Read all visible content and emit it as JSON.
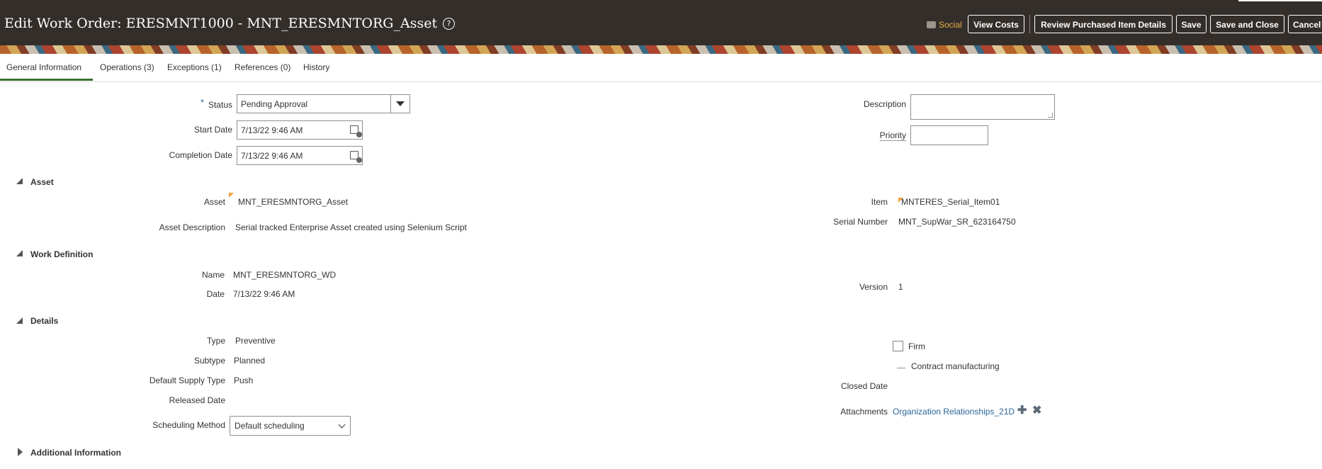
{
  "header": {
    "title": "Edit Work Order: ERESMNT1000 - MNT_ERESMNTORG_Asset",
    "help_glyph": "?",
    "social_label": "Social",
    "buttons": {
      "view_costs": "View Costs",
      "review_purchased": "Review Purchased Item Details",
      "save": "Save",
      "save_and_close": "Save and Close",
      "cancel": "Cancel"
    }
  },
  "tabs": [
    "General Information",
    "Operations (3)",
    "Exceptions (1)",
    "References (0)",
    "History"
  ],
  "general": {
    "status_required": "*",
    "status_label": "Status",
    "status_value": "Pending Approval",
    "start_date_label": "Start Date",
    "start_date_value": "7/13/22 9:46 AM",
    "completion_date_label": "Completion Date",
    "completion_date_value": "7/13/22 9:46 AM",
    "description_label": "Description",
    "description_value": "",
    "priority_label": "Priority",
    "priority_value": ""
  },
  "asset": {
    "section": "Asset",
    "asset_label": "Asset",
    "asset_value": "MNT_ERESMNTORG_Asset",
    "asset_desc_label": "Asset Description",
    "asset_desc_value": "Serial tracked Enterprise Asset created using Selenium Script",
    "item_label": "Item",
    "item_value": "MNTERES_Serial_Item01",
    "serial_label": "Serial Number",
    "serial_value": "MNT_SupWar_SR_623164750"
  },
  "work_definition": {
    "section": "Work Definition",
    "name_label": "Name",
    "name_value": "MNT_ERESMNTORG_WD",
    "date_label": "Date",
    "date_value": "7/13/22 9:46 AM",
    "version_label": "Version",
    "version_value": "1"
  },
  "details": {
    "section": "Details",
    "type_label": "Type",
    "type_value": "Preventive",
    "subtype_label": "Subtype",
    "subtype_value": "Planned",
    "supply_label": "Default Supply Type",
    "supply_value": "Push",
    "released_label": "Released Date",
    "released_value": "",
    "scheduling_label": "Scheduling Method",
    "scheduling_value": "Default scheduling",
    "firm_label": "Firm",
    "firm_checked": false,
    "contract_label": "Contract manufacturing",
    "closed_label": "Closed Date",
    "closed_value": "",
    "attachments_label": "Attachments",
    "attachments_value": "Organization Relationships_21D"
  },
  "additional": {
    "section": "Additional Information"
  },
  "colors": {
    "header_bg": "#332e2a",
    "link": "#2a6496",
    "social": "#e8b14a",
    "tab_underline": "#3a6f2f"
  }
}
